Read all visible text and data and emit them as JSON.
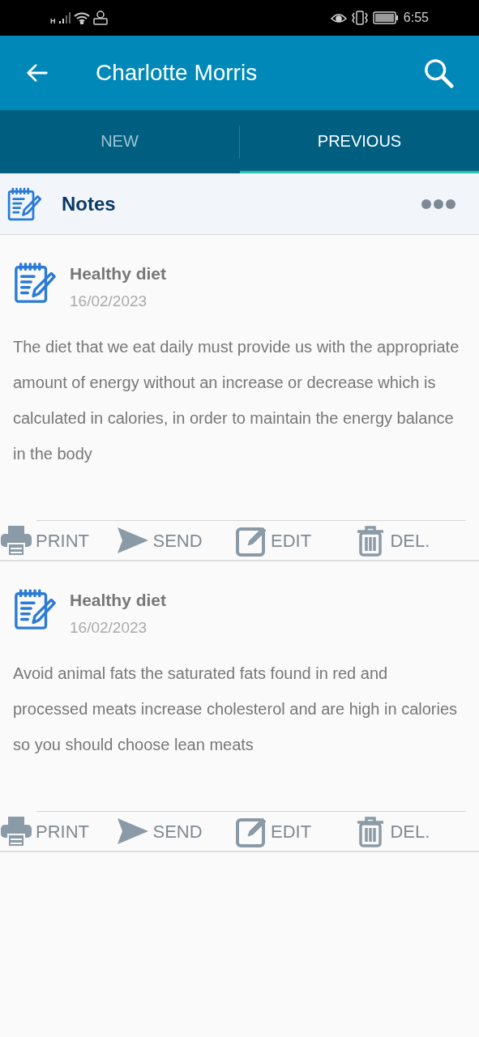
{
  "status_bar": {
    "network": "H",
    "time": "6:55"
  },
  "app_bar": {
    "title": "Charlotte Morris"
  },
  "tabs": [
    {
      "label": "NEW",
      "selected": false
    },
    {
      "label": "PREVIOUS",
      "selected": true
    }
  ],
  "section": {
    "title": "Notes"
  },
  "notes": [
    {
      "title": "Healthy diet",
      "date": "16/02/2023",
      "body": "The diet that we eat daily must provide us with the appropriate amount of energy without an increase or decrease which is calculated in calories, in order to maintain the energy balance in the body",
      "actions": [
        {
          "kind": "print",
          "label": "PRINT"
        },
        {
          "kind": "send",
          "label": "SEND"
        },
        {
          "kind": "edit",
          "label": "EDIT"
        },
        {
          "kind": "delete",
          "label": "DEL."
        }
      ]
    },
    {
      "title": "Healthy diet",
      "date": "16/02/2023",
      "body": "Avoid animal fats the saturated fats found in red and processed meats increase cholesterol and are high in calories so you should choose lean meats",
      "actions": [
        {
          "kind": "print",
          "label": "PRINT"
        },
        {
          "kind": "send",
          "label": "SEND"
        },
        {
          "kind": "edit",
          "label": "EDIT"
        },
        {
          "kind": "delete",
          "label": "DEL."
        }
      ]
    }
  ]
}
